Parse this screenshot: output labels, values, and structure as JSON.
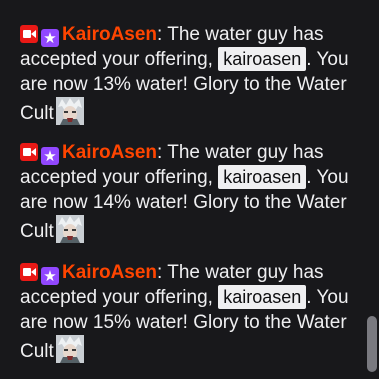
{
  "chat": {
    "messages": [
      {
        "username": "KairoAsen",
        "separator": ":",
        "text_before": " The water guy has accepted your offering, ",
        "mention": "kairoasen",
        "text_after": ". You are now 13% water! Glory to the Water Cult",
        "badges": [
          "camera-icon",
          "prime-star-icon"
        ],
        "emote": "anime-face-emote"
      },
      {
        "username": "KairoAsen",
        "separator": ":",
        "text_before": " The water guy has accepted your offering, ",
        "mention": "kairoasen",
        "text_after": ". You are now 14% water! Glory to the Water Cult",
        "badges": [
          "camera-icon",
          "prime-star-icon"
        ],
        "emote": "anime-face-emote"
      },
      {
        "username": "KairoAsen",
        "separator": ":",
        "text_before": " The water guy has accepted your offering, ",
        "mention": "kairoasen",
        "text_after": ". You are now 15% water! Glory to the Water Cult",
        "badges": [
          "camera-icon",
          "prime-star-icon"
        ],
        "emote": "anime-face-emote"
      }
    ],
    "badge_star_glyph": "★"
  },
  "colors": {
    "background": "#18181b",
    "username": "#ff4500",
    "camera_badge": "#e91916",
    "prime_badge": "#9147ff",
    "mention_bg": "#efeff1"
  }
}
